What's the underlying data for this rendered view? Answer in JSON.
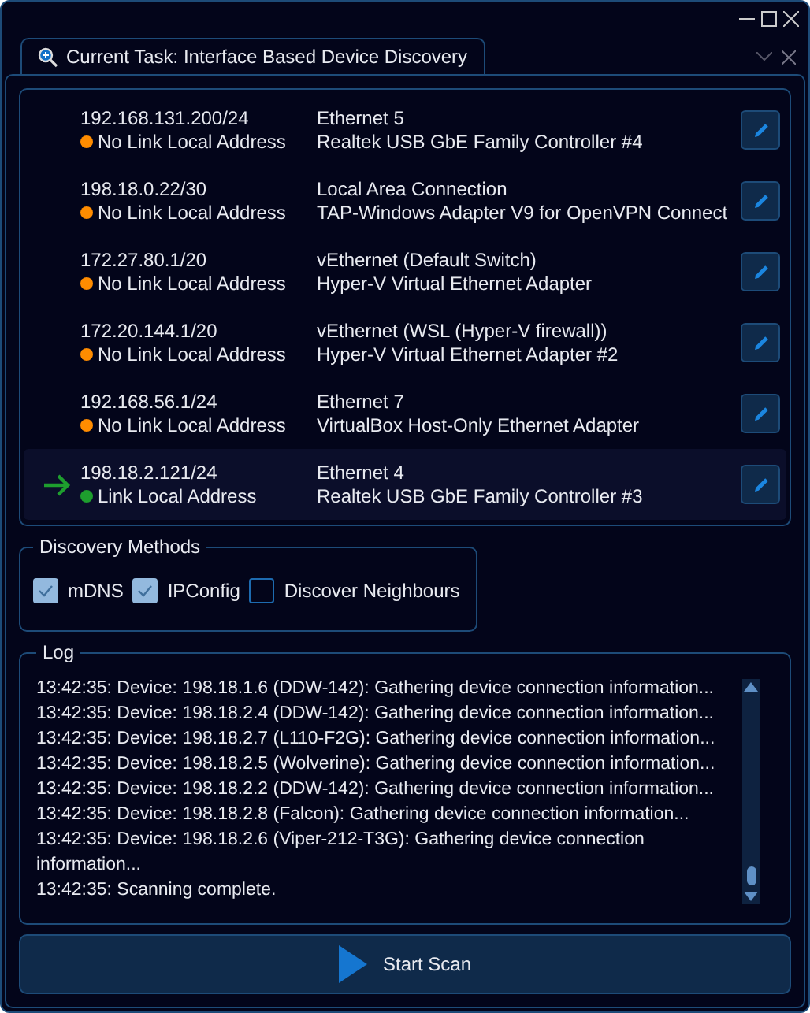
{
  "window": {
    "title": "Current Task: Interface Based Device Discovery"
  },
  "interfaces": [
    {
      "address": "192.168.131.200/24",
      "status": "No Link Local Address",
      "color": "#ff8c00",
      "name": "Ethernet 5",
      "adapter": "Realtek USB GbE Family Controller #4",
      "selected": false
    },
    {
      "address": "198.18.0.22/30",
      "status": "No Link Local Address",
      "color": "#ff8c00",
      "name": "Local Area Connection",
      "adapter": "TAP-Windows Adapter V9 for OpenVPN Connect",
      "selected": false
    },
    {
      "address": "172.27.80.1/20",
      "status": "No Link Local Address",
      "color": "#ff8c00",
      "name": "vEthernet (Default Switch)",
      "adapter": "Hyper-V Virtual Ethernet Adapter",
      "selected": false
    },
    {
      "address": "172.20.144.1/20",
      "status": "No Link Local Address",
      "color": "#ff8c00",
      "name": "vEthernet (WSL (Hyper-V firewall))",
      "adapter": "Hyper-V Virtual Ethernet Adapter #2",
      "selected": false
    },
    {
      "address": "192.168.56.1/24",
      "status": "No Link Local Address",
      "color": "#ff8c00",
      "name": "Ethernet 7",
      "adapter": "VirtualBox Host-Only Ethernet Adapter",
      "selected": false
    },
    {
      "address": "198.18.2.121/24",
      "status": "Link Local Address",
      "color": "#1e9e2e",
      "name": "Ethernet 4",
      "adapter": "Realtek USB GbE Family Controller #3",
      "selected": true
    }
  ],
  "discovery_methods": {
    "title": "Discovery Methods",
    "options": [
      {
        "label": "mDNS",
        "checked": true
      },
      {
        "label": "IPConfig",
        "checked": true
      },
      {
        "label": "Discover Neighbours",
        "checked": false
      }
    ]
  },
  "log": {
    "title": "Log",
    "lines": [
      "13:42:35: Device: 198.18.1.6 (DDW-142): Gathering device connection information...",
      "13:42:35: Device: 198.18.2.4 (DDW-142): Gathering device connection information...",
      "13:42:35: Device: 198.18.2.7 (L110-F2G): Gathering device connection information...",
      "13:42:35: Device: 198.18.2.5 (Wolverine): Gathering device connection information...",
      "13:42:35: Device: 198.18.2.2 (DDW-142): Gathering device connection information...",
      "13:42:35: Device: 198.18.2.8 (Falcon): Gathering device connection information...",
      "13:42:35: Device: 198.18.2.6 (Viper-212-T3G): Gathering device connection information...",
      "13:42:35: Scanning complete."
    ]
  },
  "start_button": {
    "label": "Start Scan"
  }
}
